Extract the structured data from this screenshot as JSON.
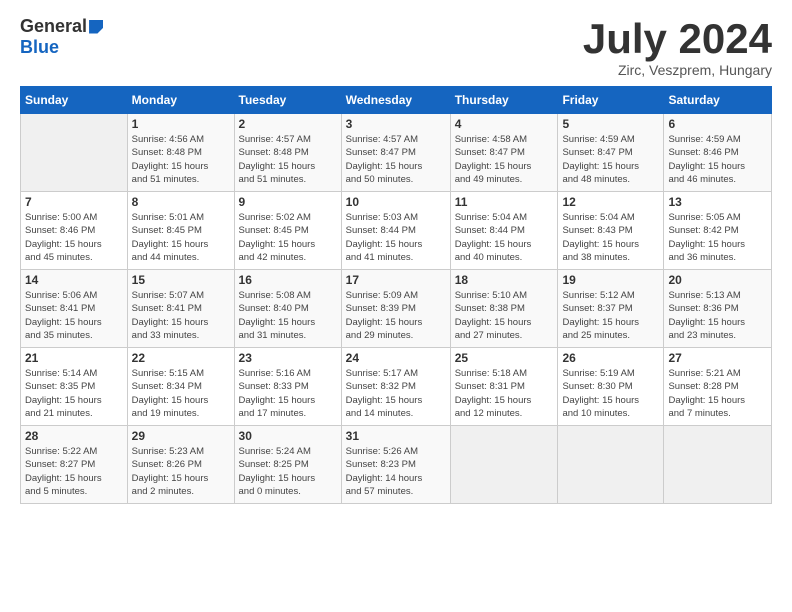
{
  "header": {
    "logo_general": "General",
    "logo_blue": "Blue",
    "month": "July 2024",
    "location": "Zirc, Veszprem, Hungary"
  },
  "days_of_week": [
    "Sunday",
    "Monday",
    "Tuesday",
    "Wednesday",
    "Thursday",
    "Friday",
    "Saturday"
  ],
  "weeks": [
    [
      {
        "day": "",
        "info": ""
      },
      {
        "day": "1",
        "info": "Sunrise: 4:56 AM\nSunset: 8:48 PM\nDaylight: 15 hours\nand 51 minutes."
      },
      {
        "day": "2",
        "info": "Sunrise: 4:57 AM\nSunset: 8:48 PM\nDaylight: 15 hours\nand 51 minutes."
      },
      {
        "day": "3",
        "info": "Sunrise: 4:57 AM\nSunset: 8:47 PM\nDaylight: 15 hours\nand 50 minutes."
      },
      {
        "day": "4",
        "info": "Sunrise: 4:58 AM\nSunset: 8:47 PM\nDaylight: 15 hours\nand 49 minutes."
      },
      {
        "day": "5",
        "info": "Sunrise: 4:59 AM\nSunset: 8:47 PM\nDaylight: 15 hours\nand 48 minutes."
      },
      {
        "day": "6",
        "info": "Sunrise: 4:59 AM\nSunset: 8:46 PM\nDaylight: 15 hours\nand 46 minutes."
      }
    ],
    [
      {
        "day": "7",
        "info": "Sunrise: 5:00 AM\nSunset: 8:46 PM\nDaylight: 15 hours\nand 45 minutes."
      },
      {
        "day": "8",
        "info": "Sunrise: 5:01 AM\nSunset: 8:45 PM\nDaylight: 15 hours\nand 44 minutes."
      },
      {
        "day": "9",
        "info": "Sunrise: 5:02 AM\nSunset: 8:45 PM\nDaylight: 15 hours\nand 42 minutes."
      },
      {
        "day": "10",
        "info": "Sunrise: 5:03 AM\nSunset: 8:44 PM\nDaylight: 15 hours\nand 41 minutes."
      },
      {
        "day": "11",
        "info": "Sunrise: 5:04 AM\nSunset: 8:44 PM\nDaylight: 15 hours\nand 40 minutes."
      },
      {
        "day": "12",
        "info": "Sunrise: 5:04 AM\nSunset: 8:43 PM\nDaylight: 15 hours\nand 38 minutes."
      },
      {
        "day": "13",
        "info": "Sunrise: 5:05 AM\nSunset: 8:42 PM\nDaylight: 15 hours\nand 36 minutes."
      }
    ],
    [
      {
        "day": "14",
        "info": "Sunrise: 5:06 AM\nSunset: 8:41 PM\nDaylight: 15 hours\nand 35 minutes."
      },
      {
        "day": "15",
        "info": "Sunrise: 5:07 AM\nSunset: 8:41 PM\nDaylight: 15 hours\nand 33 minutes."
      },
      {
        "day": "16",
        "info": "Sunrise: 5:08 AM\nSunset: 8:40 PM\nDaylight: 15 hours\nand 31 minutes."
      },
      {
        "day": "17",
        "info": "Sunrise: 5:09 AM\nSunset: 8:39 PM\nDaylight: 15 hours\nand 29 minutes."
      },
      {
        "day": "18",
        "info": "Sunrise: 5:10 AM\nSunset: 8:38 PM\nDaylight: 15 hours\nand 27 minutes."
      },
      {
        "day": "19",
        "info": "Sunrise: 5:12 AM\nSunset: 8:37 PM\nDaylight: 15 hours\nand 25 minutes."
      },
      {
        "day": "20",
        "info": "Sunrise: 5:13 AM\nSunset: 8:36 PM\nDaylight: 15 hours\nand 23 minutes."
      }
    ],
    [
      {
        "day": "21",
        "info": "Sunrise: 5:14 AM\nSunset: 8:35 PM\nDaylight: 15 hours\nand 21 minutes."
      },
      {
        "day": "22",
        "info": "Sunrise: 5:15 AM\nSunset: 8:34 PM\nDaylight: 15 hours\nand 19 minutes."
      },
      {
        "day": "23",
        "info": "Sunrise: 5:16 AM\nSunset: 8:33 PM\nDaylight: 15 hours\nand 17 minutes."
      },
      {
        "day": "24",
        "info": "Sunrise: 5:17 AM\nSunset: 8:32 PM\nDaylight: 15 hours\nand 14 minutes."
      },
      {
        "day": "25",
        "info": "Sunrise: 5:18 AM\nSunset: 8:31 PM\nDaylight: 15 hours\nand 12 minutes."
      },
      {
        "day": "26",
        "info": "Sunrise: 5:19 AM\nSunset: 8:30 PM\nDaylight: 15 hours\nand 10 minutes."
      },
      {
        "day": "27",
        "info": "Sunrise: 5:21 AM\nSunset: 8:28 PM\nDaylight: 15 hours\nand 7 minutes."
      }
    ],
    [
      {
        "day": "28",
        "info": "Sunrise: 5:22 AM\nSunset: 8:27 PM\nDaylight: 15 hours\nand 5 minutes."
      },
      {
        "day": "29",
        "info": "Sunrise: 5:23 AM\nSunset: 8:26 PM\nDaylight: 15 hours\nand 2 minutes."
      },
      {
        "day": "30",
        "info": "Sunrise: 5:24 AM\nSunset: 8:25 PM\nDaylight: 15 hours\nand 0 minutes."
      },
      {
        "day": "31",
        "info": "Sunrise: 5:26 AM\nSunset: 8:23 PM\nDaylight: 14 hours\nand 57 minutes."
      },
      {
        "day": "",
        "info": ""
      },
      {
        "day": "",
        "info": ""
      },
      {
        "day": "",
        "info": ""
      }
    ]
  ]
}
